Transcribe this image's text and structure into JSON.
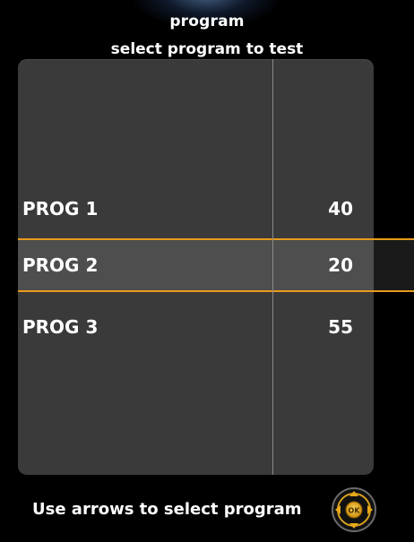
{
  "header": {
    "title": "program",
    "subtitle": "select program to test"
  },
  "program_list": {
    "rows": [
      {
        "name": "PROG 1",
        "value": "40",
        "selected": false
      },
      {
        "name": "PROG 2",
        "value": "20",
        "selected": true
      },
      {
        "name": "PROG 3",
        "value": "55",
        "selected": false
      }
    ]
  },
  "footer": {
    "hint": "Use arrows to select program",
    "ok_label": "OK"
  },
  "colors": {
    "selection_line": "#e89a1a",
    "panel_bg": "#3a3a3a",
    "ok_ring": "#e8a81a"
  },
  "icons": {
    "nav_pad": "arrow-pad-ok-icon"
  }
}
